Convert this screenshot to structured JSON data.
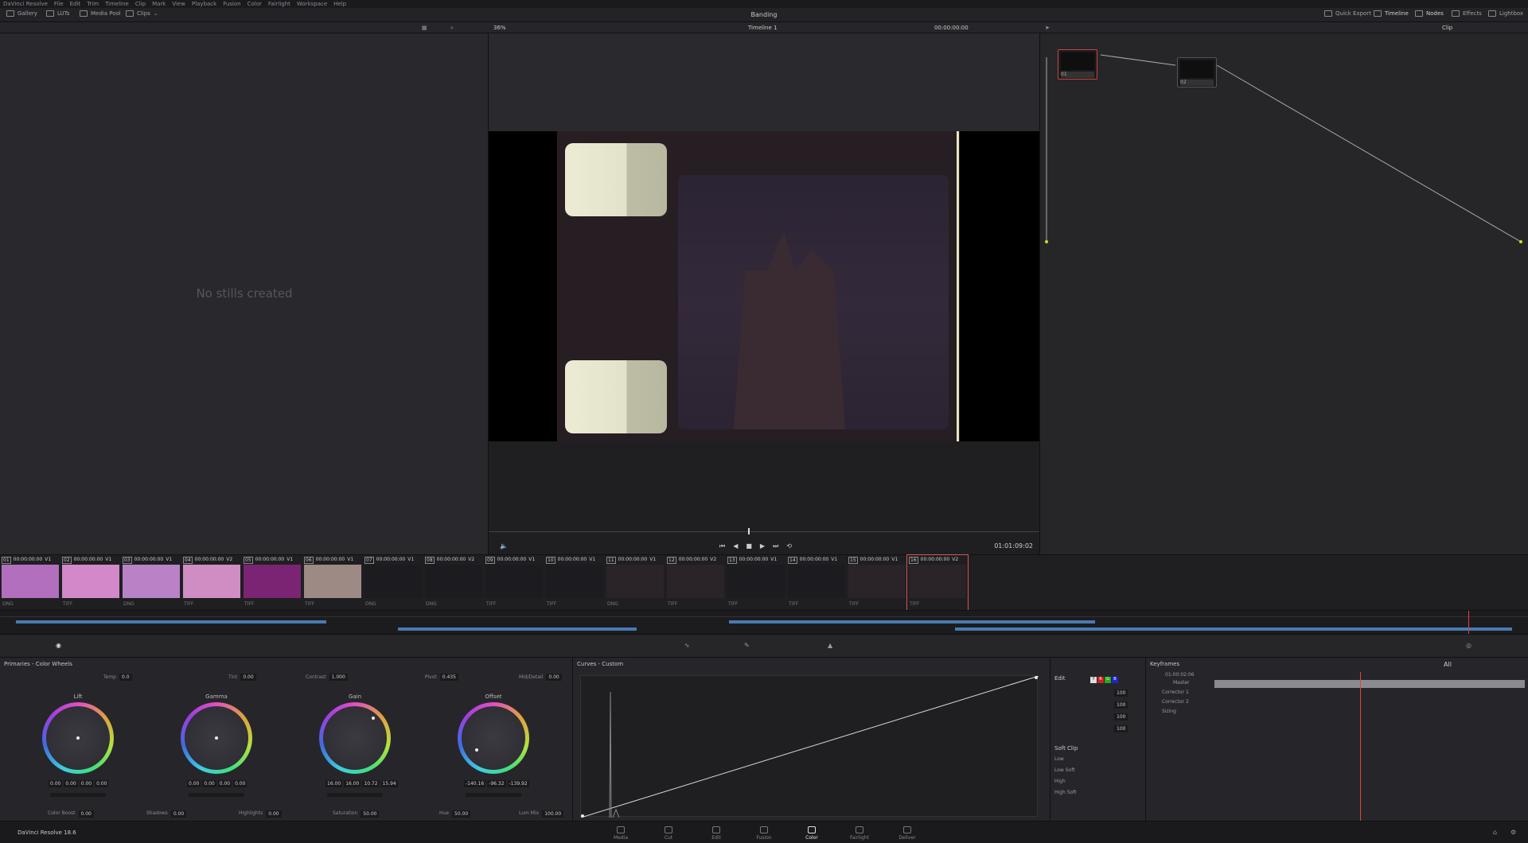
{
  "menu": [
    "DaVinci Resolve",
    "File",
    "Edit",
    "Trim",
    "Timeline",
    "Clip",
    "Mark",
    "View",
    "Playback",
    "Fusion",
    "Color",
    "Fairlight",
    "Workspace",
    "Help"
  ],
  "topbar": {
    "left": [
      "Gallery",
      "LUTs",
      "Media Pool",
      "Clips"
    ],
    "project_title": "Banding",
    "right": [
      "Quick Export",
      "Timeline",
      "Nodes",
      "Effects",
      "Lightbox"
    ]
  },
  "viewer": {
    "zoom": "36%",
    "timeline_name": "Timeline 1",
    "timecode_top": "00:00:00:00",
    "timecode": "01:01:09:02",
    "mode": "Clip"
  },
  "gallery": {
    "empty_text": "No stills created"
  },
  "nodes": [
    {
      "label": "01"
    },
    {
      "label": "02"
    }
  ],
  "clips": [
    {
      "num": "01",
      "tc": "00:00:00:00",
      "track": "V1",
      "fmt": "DNG",
      "color": "#b26fbd"
    },
    {
      "num": "02",
      "tc": "00:00:00:00",
      "track": "V1",
      "fmt": "TIFF",
      "color": "#d189c9"
    },
    {
      "num": "03",
      "tc": "00:00:00:00",
      "track": "V1",
      "fmt": "DNG",
      "color": "#b982c7"
    },
    {
      "num": "04",
      "tc": "00:00:00:00",
      "track": "V2",
      "fmt": "TIFF",
      "color": "#cf8dc3"
    },
    {
      "num": "05",
      "tc": "00:00:00:00",
      "track": "V1",
      "fmt": "TIFF",
      "color": "#7b2474"
    },
    {
      "num": "06",
      "tc": "00:00:00:00",
      "track": "V1",
      "fmt": "TIFF",
      "color": "#9e8a84"
    },
    {
      "num": "07",
      "tc": "00:00:00:00",
      "track": "V1",
      "fmt": "DNG",
      "color": "#1c1c20"
    },
    {
      "num": "08",
      "tc": "00:00:00:00",
      "track": "V2",
      "fmt": "DNG",
      "color": "#1c1c20"
    },
    {
      "num": "09",
      "tc": "00:00:00:00",
      "track": "V1",
      "fmt": "TIFF",
      "color": "#1c1c20"
    },
    {
      "num": "10",
      "tc": "00:00:00:00",
      "track": "V1",
      "fmt": "TIFF",
      "color": "#1c1c20"
    },
    {
      "num": "11",
      "tc": "00:00:00:00",
      "track": "V1",
      "fmt": "DNG",
      "color": "#2a2328"
    },
    {
      "num": "12",
      "tc": "00:00:00:00",
      "track": "V2",
      "fmt": "TIFF",
      "color": "#2a2328"
    },
    {
      "num": "13",
      "tc": "00:00:00:00",
      "track": "V1",
      "fmt": "TIFF",
      "color": "#1c1c20"
    },
    {
      "num": "14",
      "tc": "00:00:00:00",
      "track": "V1",
      "fmt": "TIFF",
      "color": "#1c1c20"
    },
    {
      "num": "15",
      "tc": "00:00:00:00",
      "track": "V1",
      "fmt": "TIFF",
      "color": "#2a2328"
    },
    {
      "num": "16",
      "tc": "00:00:00:00",
      "track": "V2",
      "fmt": "TIFF",
      "color": "#2a2328"
    }
  ],
  "primaries": {
    "title": "Primaries - Color Wheels",
    "params_top": [
      {
        "label": "Temp",
        "value": "0.0"
      },
      {
        "label": "Tint",
        "value": "0.00"
      },
      {
        "label": "Contrast",
        "value": "1.000"
      },
      {
        "label": "Pivot",
        "value": "0.435"
      },
      {
        "label": "Mid/Detail",
        "value": "0.00"
      }
    ],
    "wheels": [
      {
        "name": "Lift",
        "values": [
          "0.00",
          "0.00",
          "0.00",
          "0.00"
        ]
      },
      {
        "name": "Gamma",
        "values": [
          "0.00",
          "0.00",
          "0.00",
          "0.00"
        ]
      },
      {
        "name": "Gain",
        "values": [
          "16.00",
          "16.00",
          "10.72",
          "15.94"
        ]
      },
      {
        "name": "Offset",
        "values": [
          "-140.16",
          "-96.32",
          "-139.92"
        ]
      }
    ],
    "params_bottom": [
      {
        "label": "Color Boost",
        "value": "0.00"
      },
      {
        "label": "Shadows",
        "value": "0.00"
      },
      {
        "label": "Highlights",
        "value": "0.00"
      },
      {
        "label": "Saturation",
        "value": "50.00"
      },
      {
        "label": "Hue",
        "value": "50.00"
      },
      {
        "label": "Lum Mix",
        "value": "100.00"
      }
    ]
  },
  "curves": {
    "title": "Curves - Custom"
  },
  "edit": {
    "label": "Edit",
    "values": [
      "100",
      "100",
      "100",
      "100"
    ],
    "soft_clip": "Soft Clip",
    "soft_labels": [
      "Low",
      "Low Soft",
      "High",
      "High Soft"
    ]
  },
  "keyframes": {
    "title": "Keyframes",
    "filter": "All",
    "timecode": "01:00:02:06",
    "tracks": [
      "Master",
      "Corrector 1",
      "Corrector 2",
      "Sizing"
    ]
  },
  "app_label": "DaVinci Resolve 18.6",
  "pages": [
    {
      "label": "Media",
      "active": false
    },
    {
      "label": "Cut",
      "active": false
    },
    {
      "label": "Edit",
      "active": false
    },
    {
      "label": "Fusion",
      "active": false
    },
    {
      "label": "Color",
      "active": true
    },
    {
      "label": "Fairlight",
      "active": false
    },
    {
      "label": "Deliver",
      "active": false
    }
  ]
}
